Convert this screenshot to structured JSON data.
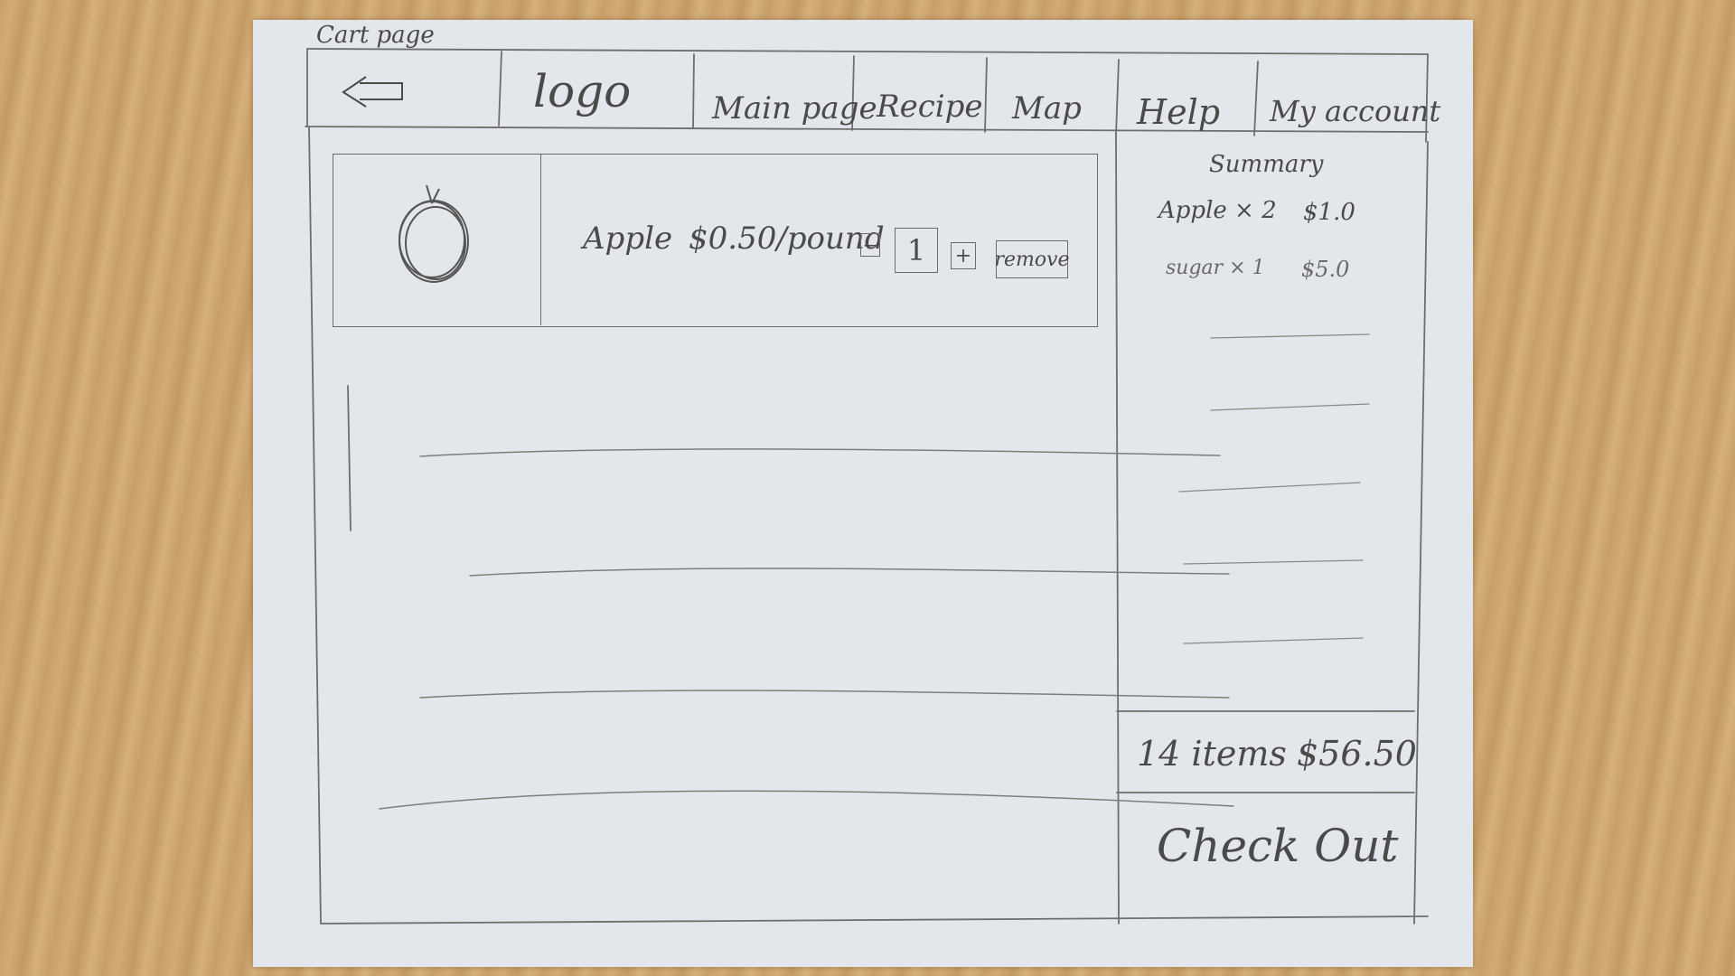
{
  "page_label": "Cart page",
  "header": {
    "logo": "logo",
    "nav": [
      {
        "label": "Main page"
      },
      {
        "label": "Recipe"
      },
      {
        "label": "Map"
      },
      {
        "label": "Help"
      },
      {
        "label": "My account"
      }
    ]
  },
  "cart": {
    "items": [
      {
        "name": "Apple",
        "price": "$0.50/pound",
        "quantity": "1",
        "minus_label": "−",
        "plus_label": "+",
        "remove_label": "remove",
        "image_icon": "apple-icon"
      }
    ]
  },
  "summary": {
    "title": "Summary",
    "lines": [
      {
        "item": "Apple × 2",
        "amount": "$1.0"
      },
      {
        "item": "sugar × 1",
        "amount": "$5.0"
      }
    ],
    "total_items": "14 items",
    "total_amount": "$56.50",
    "checkout_label": "Check Out"
  }
}
